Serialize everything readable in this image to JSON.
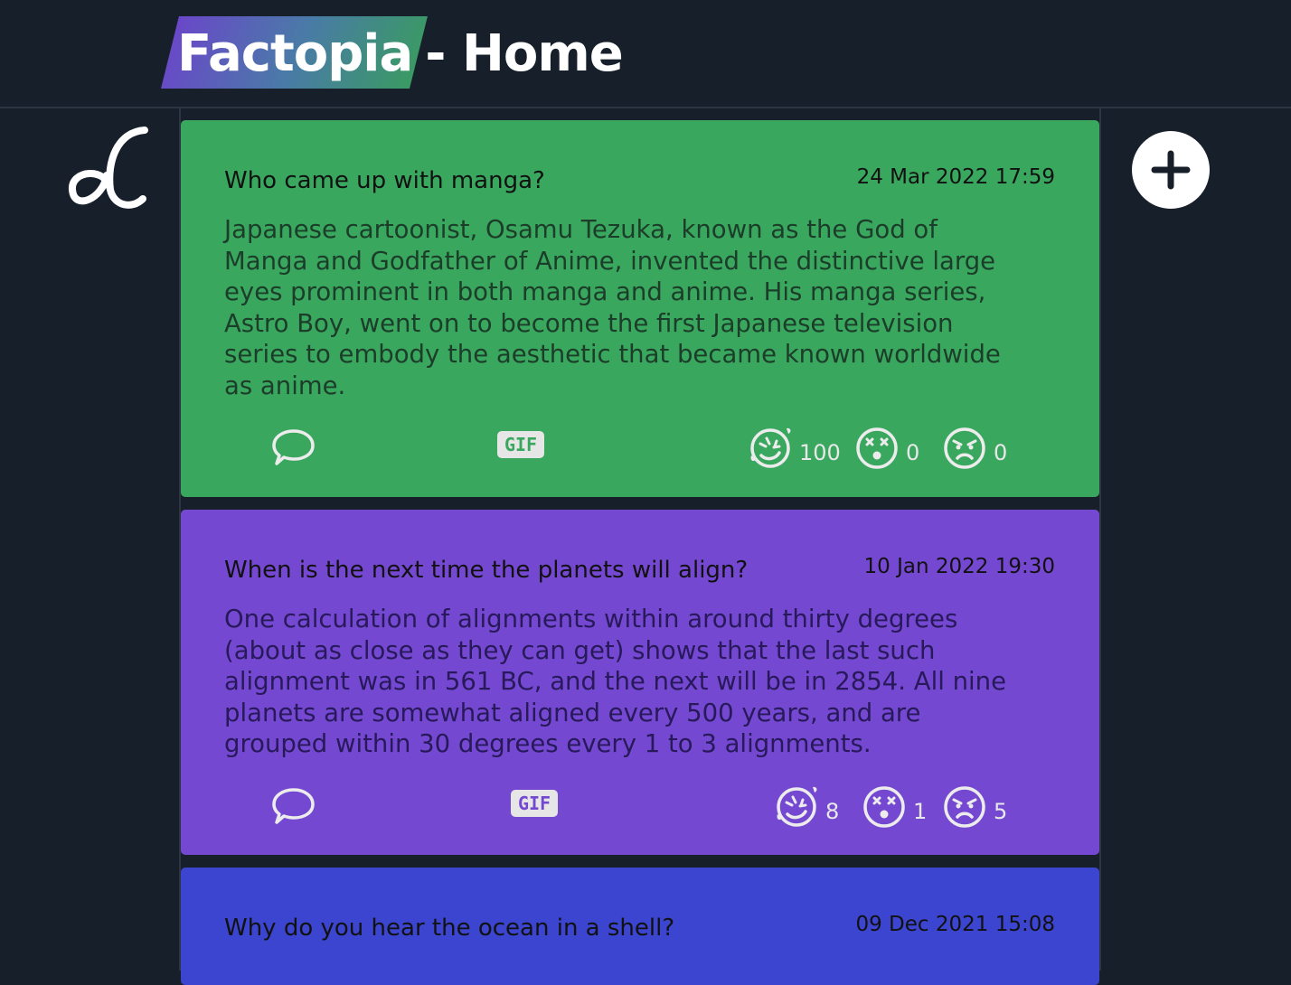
{
  "header": {
    "brand": "Factopia",
    "separator": "- Home"
  },
  "posts": [
    {
      "question": "Who came up with manga?",
      "date": "24 Mar 2022 17:59",
      "answer": "Japanese cartoonist, Osamu Tezuka, known as the God of\nManga and Godfather of Anime, invented the distinctive large\neyes prominent in both manga and anime. His manga series,\nAstro Boy, went on to become the first Japanese television\nseries to embody the aesthetic that became known worldwide\nas anime.",
      "gif_label": "GIF",
      "reactions": {
        "laugh": "100",
        "shocked": "0",
        "angry": "0"
      },
      "color": "#3aa75e"
    },
    {
      "question": "When is the next time the planets will align?",
      "date": "10 Jan 2022 19:30",
      "answer": "One calculation of alignments within around thirty degrees\n(about as close as they can get) shows that the last such\nalignment was in 561 BC, and the next will be in 2854. All nine\nplanets are somewhat aligned every 500 years, and are\ngrouped within 30 degrees every 1 to 3 alignments.",
      "gif_label": "GIF",
      "reactions": {
        "laugh": "8",
        "shocked": "1",
        "angry": "5"
      },
      "color": "#7548d1"
    },
    {
      "question": "Why do you hear the ocean in a shell?",
      "date": "09 Dec 2021 15:08",
      "color": "#3b45cf"
    }
  ],
  "icons": {
    "logo": "alpha-logo-icon",
    "add": "plus-icon",
    "comment": "speech-bubble-icon",
    "laugh": "laughing-emoji-icon",
    "shocked": "shocked-emoji-icon",
    "angry": "angry-emoji-icon"
  }
}
